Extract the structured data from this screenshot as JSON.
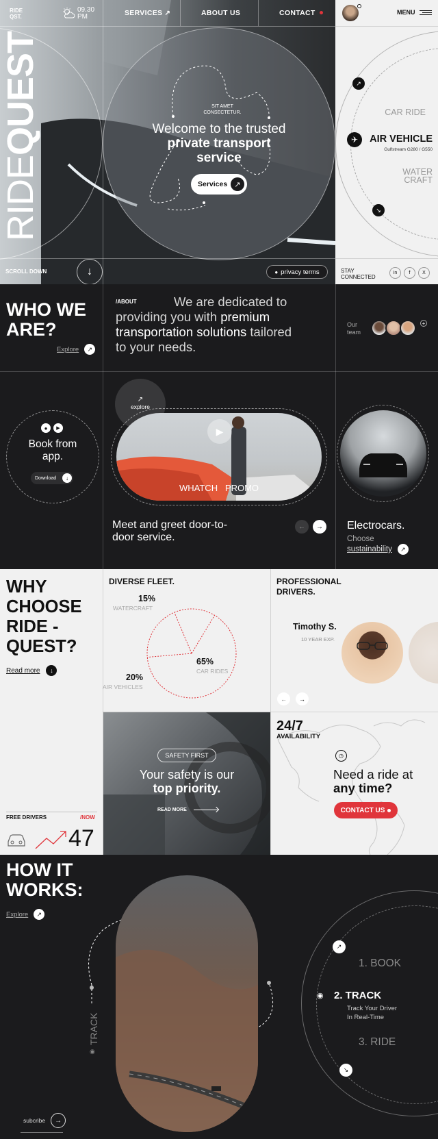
{
  "header": {
    "logo_line1": "RIDE",
    "logo_line2": "QST.",
    "time": "09.30",
    "meridiem": "PM",
    "nav": [
      "SERVICES",
      "ABOUT US",
      "CONTACT"
    ],
    "menu_label": "MENU"
  },
  "hero": {
    "brand_light": "RIDE",
    "brand_bold": "QUEST",
    "kicker_line1": "SIT AMET",
    "kicker_line2": "CONSECTETUR.",
    "title_line1": "Welcome to the trusted",
    "title_line2": "private transport",
    "title_line3": "service",
    "cta_label": "Services",
    "scroll_label": "SCROLL DOWN",
    "privacy_label": "privacy terms"
  },
  "vehicle_menu": {
    "car_ride": "CAR RIDE",
    "air_vehicle": "AIR VEHICLE",
    "air_models": "Gulfstream G280 / G550",
    "water_craft_line1": "WATER",
    "water_craft_line2": "CRAFT"
  },
  "social": {
    "stay_line1": "STAY",
    "stay_line2": "CONNECTED",
    "links": [
      "in",
      "f",
      "X"
    ]
  },
  "about": {
    "heading_line1": "WHO WE",
    "heading_line2": "ARE?",
    "explore_label": "Explore",
    "tag": "/ABOUT",
    "text_line1": "We are dedicated to",
    "text_line2_a": "providing you with ",
    "text_line2_b": "premium",
    "text_line3_a": "transportation solutions",
    "text_line3_b": " tailored",
    "text_line4": "to your needs.",
    "team_line1": "Our",
    "team_line2": "team"
  },
  "services": {
    "book_line1": "Book from",
    "book_line2": "app.",
    "download_label": "Download",
    "explore_label": "explore",
    "promo_label": "WHATCH   PROMO",
    "meet_line1": "Meet and greet door-to-",
    "meet_line2": "door service.",
    "electro_title": "Electrocars.",
    "choose_label": "Choose",
    "sustainability_label": "sustainability"
  },
  "why": {
    "heading": [
      "WHY",
      "CHOOSE",
      "RIDE -",
      "QUEST?"
    ],
    "read_more": "Read more",
    "free_drivers": "FREE DRIVERS",
    "now": "/NOW",
    "count": "47"
  },
  "fleet": {
    "title": "DIVERSE FLEET."
  },
  "chart_data": {
    "type": "pie",
    "title": "DIVERSE FLEET.",
    "categories": [
      "CAR RIDES",
      "AIR VEHICLES",
      "WATERCRAFT"
    ],
    "values": [
      65,
      20,
      15
    ],
    "labels": [
      "65%",
      "20%",
      "15%"
    ],
    "colors": [
      "#e0353b"
    ]
  },
  "drivers": {
    "title_line1": "PROFESSIONAL",
    "title_line2": "DRIVERS.",
    "name": "Timothy S.",
    "experience": "10 YEAR EXP."
  },
  "safety": {
    "badge": "SAFETY FIRST",
    "line1": "Your safety is our",
    "line2": "top priority.",
    "read_more": "READ MORE"
  },
  "availability": {
    "big": "24/7",
    "label": "AVAILABILITY",
    "need_line1": "Need a ride at",
    "need_line2": "any time?",
    "contact_label": "CONTACT US"
  },
  "how": {
    "heading_line1": "HOW IT",
    "heading_line2": "WORKS:",
    "explore_label": "Explore",
    "track_vertical": "TRACK",
    "step1": "1. BOOK",
    "step2": "2. TRACK",
    "step2_sub1": "Track Your Driver",
    "step2_sub2": "In Real-Time",
    "step3": "3. RIDE",
    "subscribe_label": "subcribe"
  },
  "colors": {
    "accent": "#e0353b",
    "dark": "#1b1b1d",
    "light": "#f1f1f1"
  }
}
